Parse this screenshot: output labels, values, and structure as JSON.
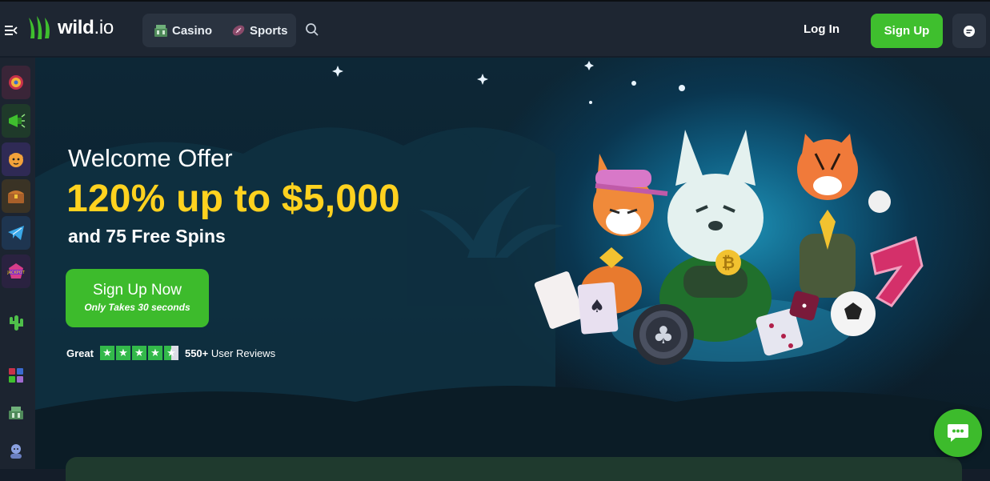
{
  "header": {
    "logo_text": "wild",
    "logo_suffix": ".io",
    "nav": [
      {
        "label": "Casino",
        "icon": "casino-icon"
      },
      {
        "label": "Sports",
        "icon": "football-icon"
      }
    ],
    "login_label": "Log In",
    "signup_label": "Sign Up"
  },
  "sidebar": {
    "items": [
      "wheel-icon",
      "megaphone-icon",
      "tiger-icon",
      "treasure-chest-icon",
      "telegram-icon",
      "jackpot-icon",
      "cactus-icon",
      "grid-icon",
      "casino-building-icon",
      "avatar-icon"
    ]
  },
  "hero": {
    "title": "Welcome Offer",
    "headline": "120% up to $5,000",
    "subline": "and 75 Free Spins",
    "cta_main": "Sign Up Now",
    "cta_sub": "Only Takes 30 seconds",
    "rating_word": "Great",
    "rating_stars": 4.5,
    "reviews_count": "550+",
    "reviews_label": "User Reviews"
  },
  "colors": {
    "accent_green": "#3dbb2c",
    "headline_yellow": "#ffd21f",
    "topbar": "#1e2632",
    "star_green": "#33b94a"
  }
}
